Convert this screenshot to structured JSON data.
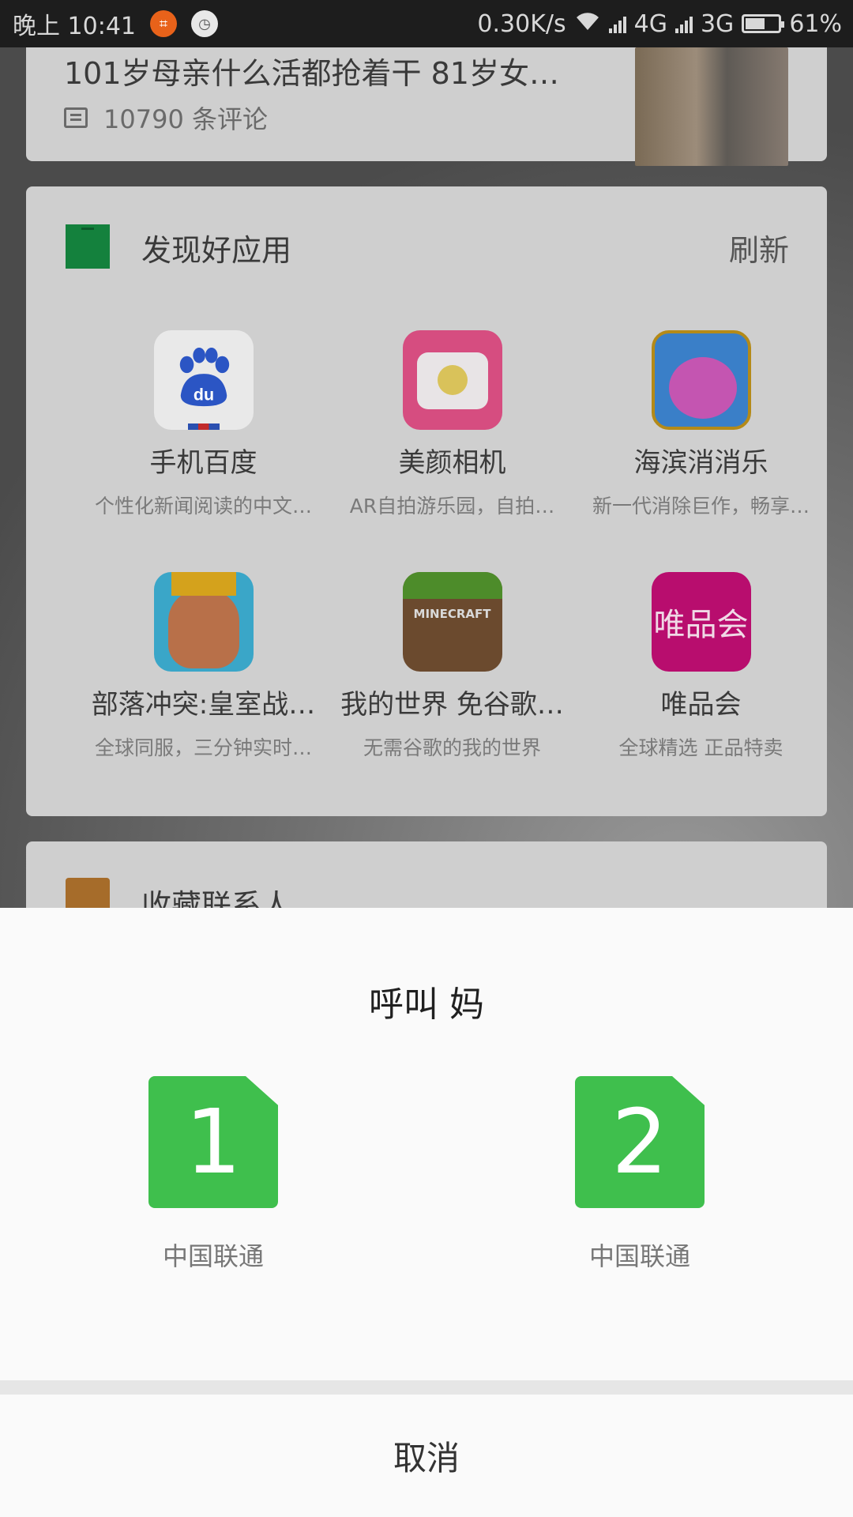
{
  "status_bar": {
    "time": "晚上 10:41",
    "net_speed": "0.30K/s",
    "net1": "4G",
    "net2": "3G",
    "battery": "61%",
    "battery_level": 0.61
  },
  "news": {
    "title": "101岁母亲什么活都抢着干 81岁女…",
    "comments": "10790 条评论"
  },
  "apps_section": {
    "title": "发现好应用",
    "refresh": "刷新",
    "items": [
      {
        "name": "手机百度",
        "desc": "个性化新闻阅读的中文…",
        "icon": "baidu-icon"
      },
      {
        "name": "美颜相机",
        "desc": "AR自拍游乐园，自拍…",
        "icon": "meiyan-camera-icon"
      },
      {
        "name": "海滨消消乐",
        "desc": "新一代消除巨作，畅享…",
        "icon": "haibin-xiaoxiaole-icon"
      },
      {
        "name": "部落冲突:皇室战…",
        "desc": "全球同服，三分钟实时…",
        "icon": "clash-royale-icon"
      },
      {
        "name": "我的世界 免谷歌…",
        "desc": "无需谷歌的我的世界",
        "icon": "minecraft-icon"
      },
      {
        "name": "唯品会",
        "desc": "全球精选  正品特卖",
        "icon": "vipshop-icon"
      }
    ],
    "minecraft_logo": "MINECRAFT",
    "vip_logo": "唯品会"
  },
  "favorites": {
    "title": "收藏联系人"
  },
  "call_sheet": {
    "title": "呼叫 妈",
    "sims": [
      {
        "number": "1",
        "carrier": "中国联通"
      },
      {
        "number": "2",
        "carrier": "中国联通"
      }
    ],
    "cancel": "取消",
    "sim_color": "#3fbf4d"
  }
}
